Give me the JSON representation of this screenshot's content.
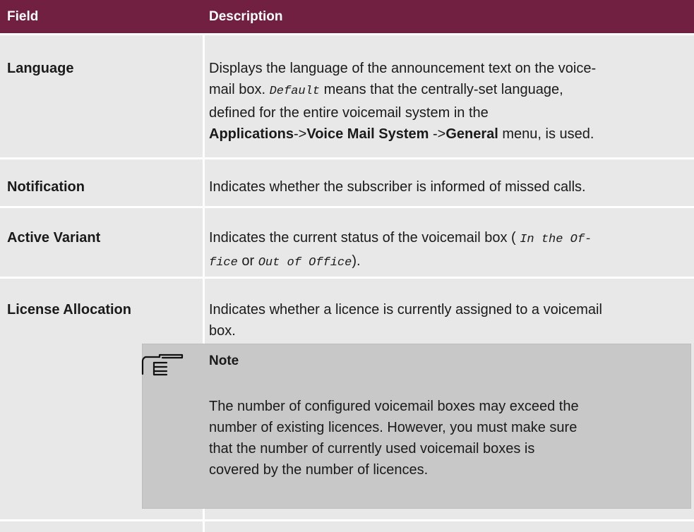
{
  "table": {
    "headers": {
      "field": "Field",
      "description": "Description"
    },
    "rows": [
      {
        "field": "Language",
        "desc": {
          "t1": "Displays the language of the announcement text on the voice-",
          "t2": "mail box. ",
          "code_default": "Default",
          "t3": " means that the centrally-set language,",
          "t4": "defined for the entire voicemail system in the",
          "menu1": "Applications",
          "sep1": "->",
          "menu2": "Voice Mail System",
          "sep2": " ->",
          "menu3": "General",
          "t5": " menu, is used."
        }
      },
      {
        "field": "Notification",
        "desc": {
          "t1": "Indicates whether the subscriber is informed of missed calls."
        }
      },
      {
        "field": "Active Variant",
        "desc": {
          "t1": "Indicates the current status of the voicemail box ( ",
          "code1a": "In the Of-",
          "code1b": "fice",
          "t2": " or ",
          "code2": "Out of Office",
          "t3": ")."
        }
      },
      {
        "field": "License Allocation",
        "desc": {
          "t1": "Indicates whether a licence is currently assigned to a voicemail",
          "t2": "box."
        }
      }
    ]
  },
  "note": {
    "icon": "pointing-hand-icon",
    "title": "Note",
    "lines": [
      "The number of configured voicemail boxes may exceed the",
      "number of existing licences. However, you must make sure",
      "that the number of currently used voicemail boxes is",
      "covered by the number of licences."
    ]
  },
  "colors": {
    "header_bg": "#722041",
    "row_bg": "#e8e8e8",
    "note_bg": "#c8c8c8"
  }
}
